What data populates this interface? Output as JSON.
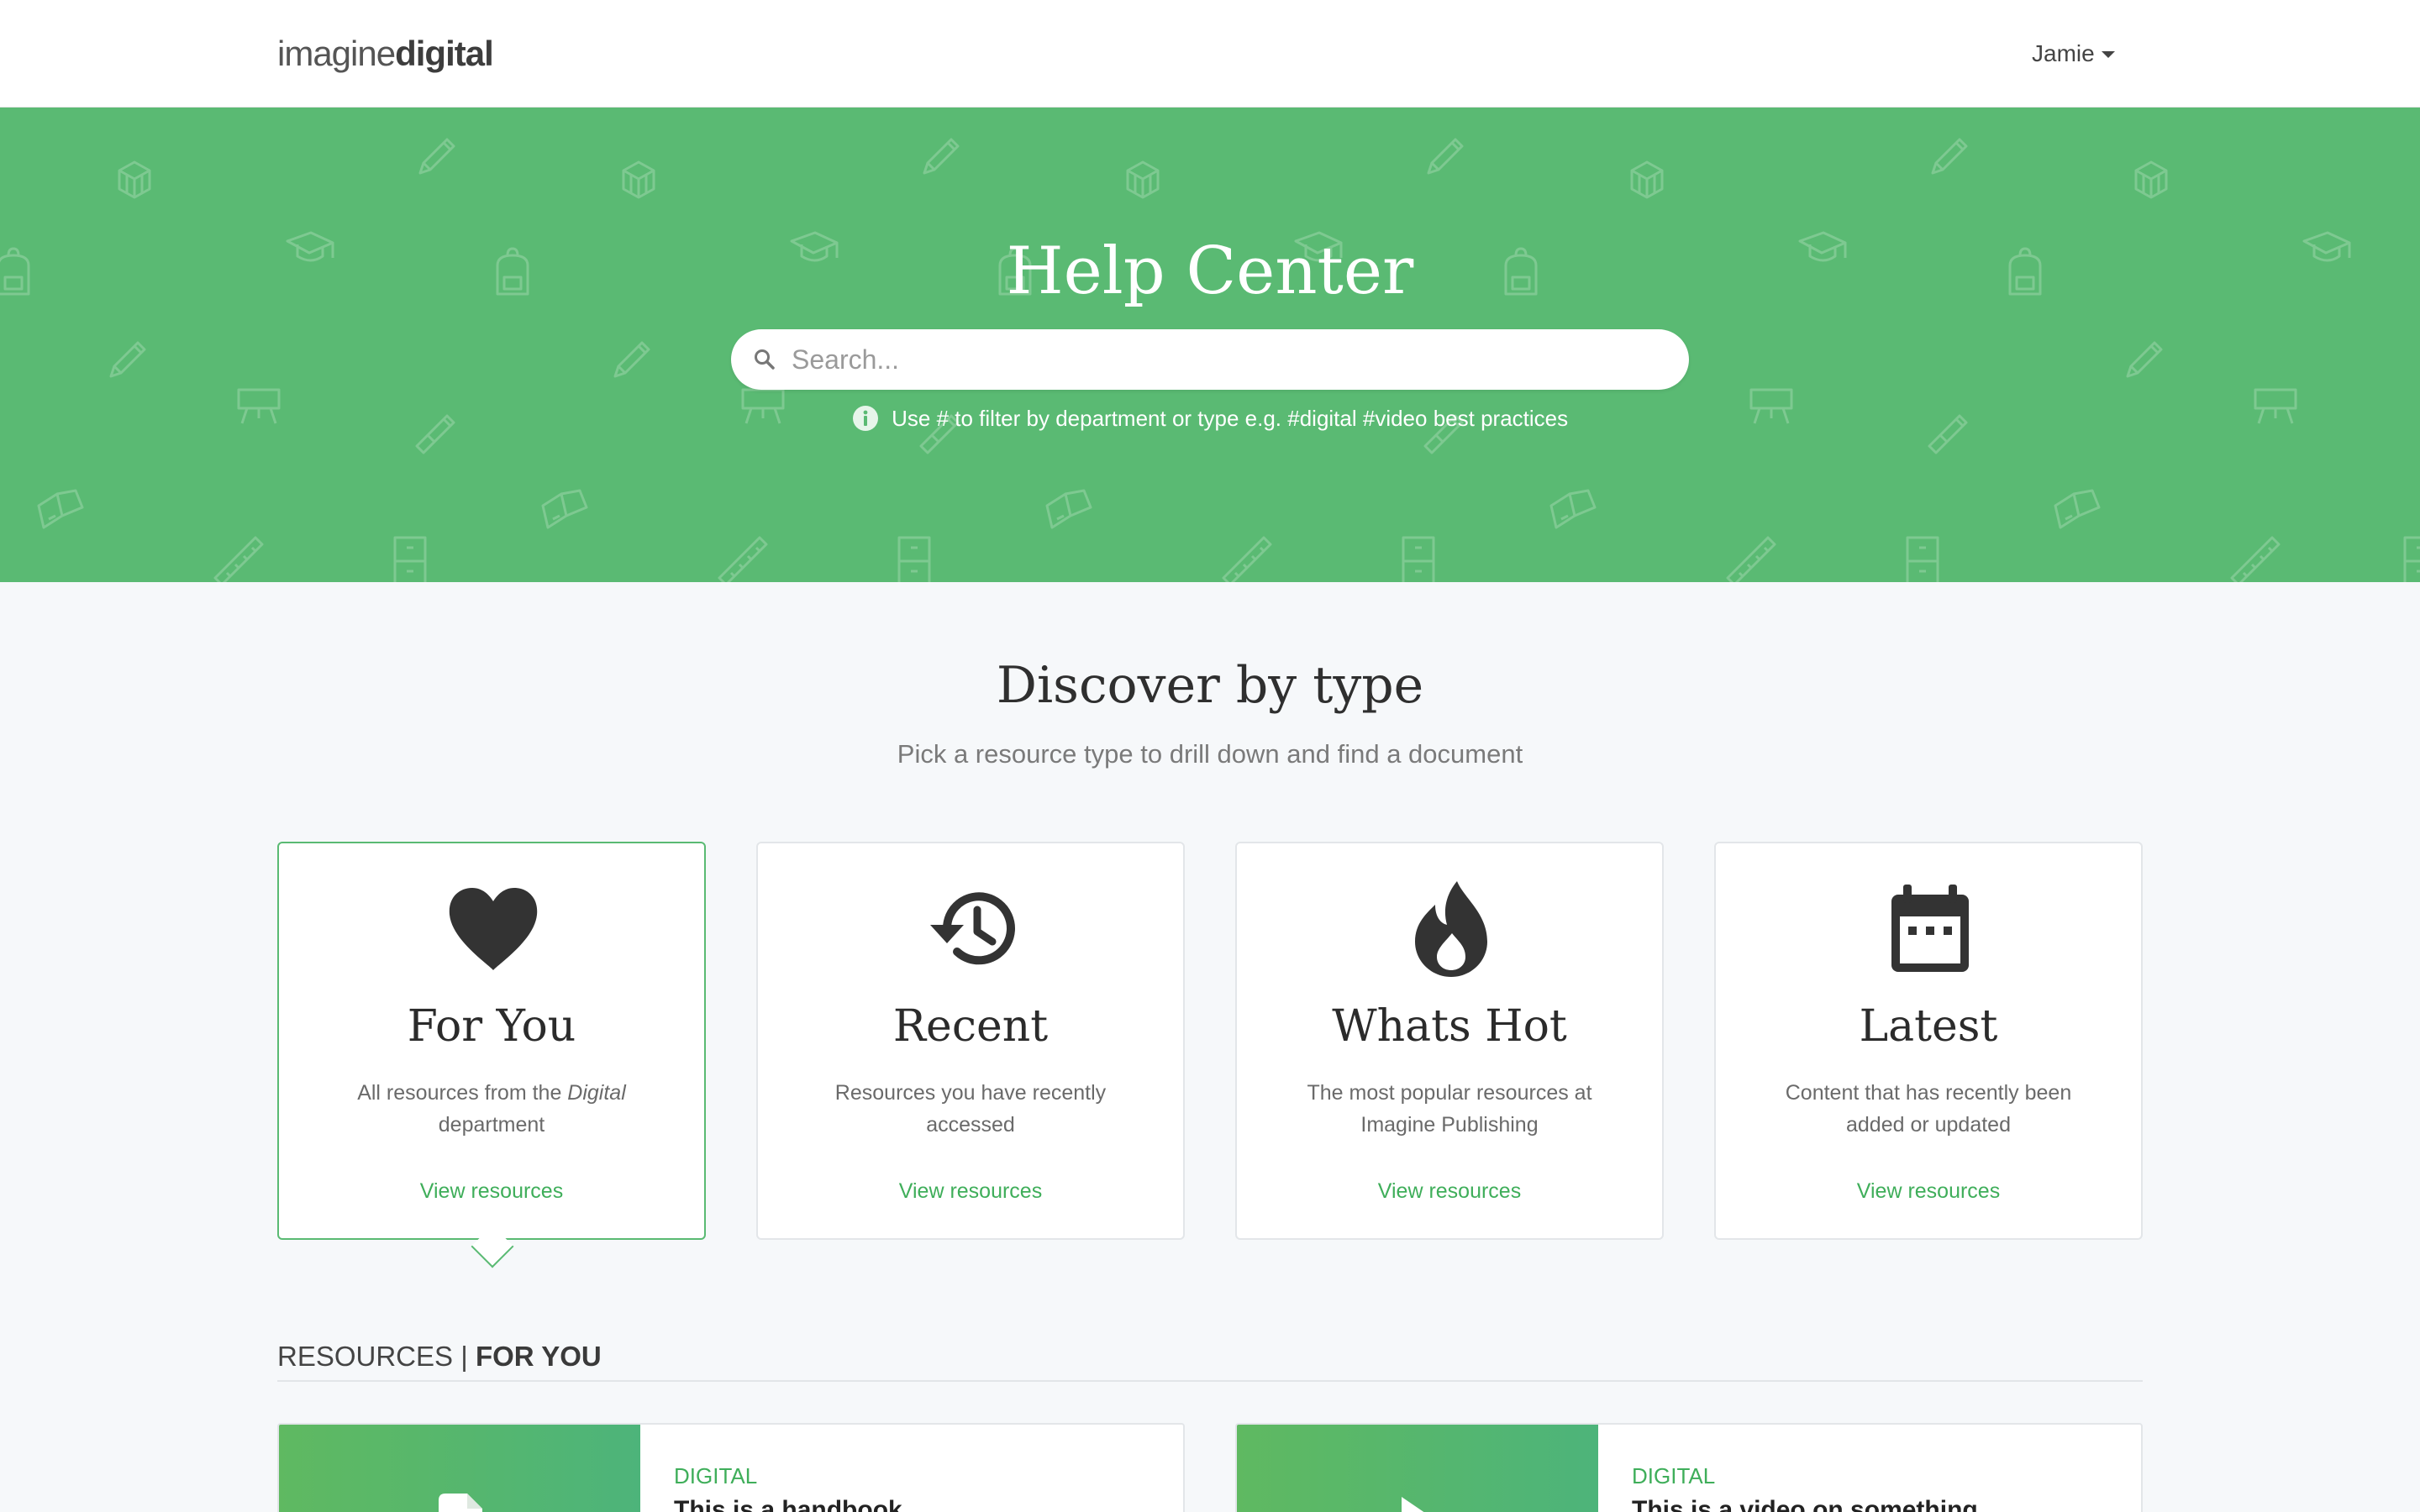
{
  "header": {
    "logo_light": "imagine",
    "logo_bold": "digital",
    "user_name": "Jamie"
  },
  "hero": {
    "title": "Help Center",
    "search_placeholder": "Search...",
    "hint": "Use # to filter by department or type e.g. #digital #video best practices",
    "background_color": "#5aba73"
  },
  "discover": {
    "title": "Discover by type",
    "subtitle": "Pick a resource type to drill down and find a document",
    "cards": [
      {
        "icon": "heart-icon",
        "title": "For You",
        "desc_before": "All resources from the ",
        "desc_italic": "Digital",
        "desc_after": " department",
        "link": "View resources",
        "active": true
      },
      {
        "icon": "history-icon",
        "title": "Recent",
        "desc": "Resources you have recently accessed",
        "link": "View resources",
        "active": false
      },
      {
        "icon": "flame-icon",
        "title": "Whats Hot",
        "desc": "The most popular resources at Imagine Publishing",
        "link": "View resources",
        "active": false
      },
      {
        "icon": "calendar-icon",
        "title": "Latest",
        "desc": "Content that has recently been added or updated",
        "link": "View resources",
        "active": false
      }
    ]
  },
  "resources": {
    "heading_prefix": "RESOURCES",
    "heading_sep": "|",
    "heading_section": "FOR YOU",
    "items": [
      {
        "category": "DIGITAL",
        "title": "This is a handbook",
        "icon": "document-icon"
      },
      {
        "category": "DIGITAL",
        "title": "This is a video on something",
        "icon": "play-icon"
      }
    ]
  },
  "colors": {
    "accent": "#5aba73",
    "link": "#3fae5a",
    "page_background": "#f6f8fa"
  }
}
